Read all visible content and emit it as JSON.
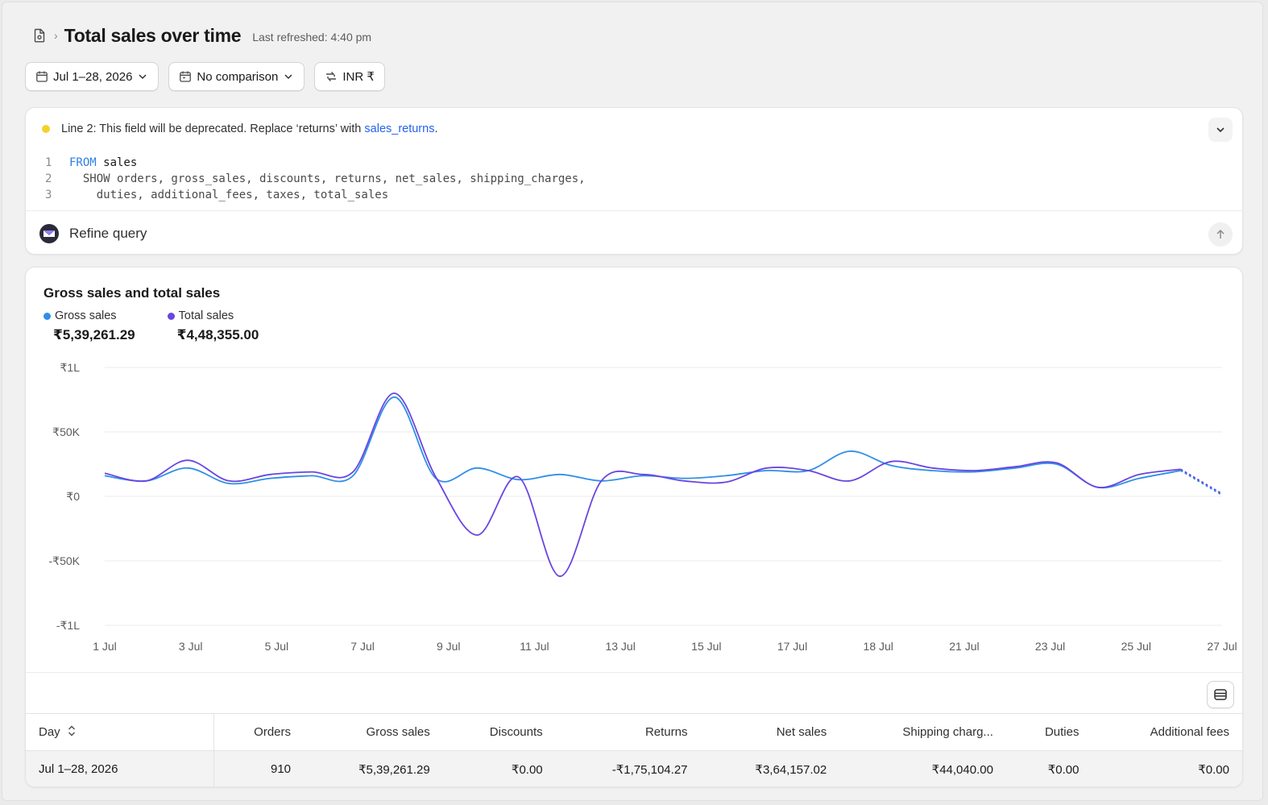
{
  "header": {
    "title": "Total sales over time",
    "last_refreshed": "Last refreshed: 4:40 pm"
  },
  "toolbar": {
    "date_range": "Jul 1–28, 2026",
    "comparison": "No comparison",
    "currency": "INR ₹"
  },
  "query": {
    "warning_prefix": "Line 2: This field will be deprecated. Replace ‘returns’ with ",
    "warning_link": "sales_returns",
    "warning_suffix": ".",
    "lines": [
      {
        "num": "1",
        "keyword": "FROM",
        "rest": " sales"
      },
      {
        "num": "2",
        "text": "  SHOW orders, gross_sales, discounts, returns, net_sales, shipping_charges,"
      },
      {
        "num": "3",
        "text": "    duties, additional_fees, taxes, total_sales"
      }
    ],
    "refine_label": "Refine query"
  },
  "colors": {
    "gross_sales": "#2f8fe8",
    "total_sales": "#6a45e0",
    "warning": "#f5d22b"
  },
  "chart_data": {
    "type": "line",
    "title": "Gross sales and total sales",
    "x": [
      "1 Jul",
      "2 Jul",
      "3 Jul",
      "4 Jul",
      "5 Jul",
      "6 Jul",
      "7 Jul",
      "8 Jul",
      "9 Jul",
      "10 Jul",
      "11 Jul",
      "12 Jul",
      "13 Jul",
      "14 Jul",
      "15 Jul",
      "16 Jul",
      "17 Jul",
      "18 Jul",
      "19 Jul",
      "20 Jul",
      "21 Jul",
      "22 Jul",
      "23 Jul",
      "24 Jul",
      "25 Jul",
      "26 Jul",
      "27 Jul",
      "28 Jul"
    ],
    "tick_labels": [
      "1 Jul",
      "3 Jul",
      "5 Jul",
      "7 Jul",
      "9 Jul",
      "11 Jul",
      "13 Jul",
      "15 Jul",
      "17 Jul",
      "18 Jul",
      "21 Jul",
      "23 Jul",
      "25 Jul",
      "27 Jul"
    ],
    "y_tick_labels": [
      "₹1L",
      "₹50K",
      "₹0",
      "-₹50K",
      "-₹1L"
    ],
    "y_ticks": [
      100000,
      50000,
      0,
      -50000,
      -100000
    ],
    "ylim": [
      -100000,
      100000
    ],
    "grid": true,
    "series": [
      {
        "name": "Gross sales",
        "total": "₹5,39,261.29",
        "values": [
          16000,
          12000,
          22000,
          10000,
          14000,
          16000,
          16000,
          77000,
          14000,
          22000,
          13000,
          17000,
          12000,
          16000,
          14000,
          16000,
          20000,
          20000,
          35000,
          24000,
          20000,
          19000,
          22000,
          25000,
          7000,
          14000,
          20000,
          1000
        ],
        "projected_from": 26
      },
      {
        "name": "Total sales",
        "total": "₹4,48,355.00",
        "values": [
          18000,
          12000,
          28000,
          12000,
          17000,
          19000,
          19000,
          80000,
          15000,
          -30000,
          15000,
          -62000,
          12000,
          17000,
          12000,
          11000,
          22000,
          20000,
          12000,
          27000,
          22000,
          20000,
          23000,
          26000,
          7000,
          17000,
          21000,
          2000
        ],
        "projected_from": 26
      }
    ]
  },
  "table": {
    "columns": [
      "Day",
      "Orders",
      "Gross sales",
      "Discounts",
      "Returns",
      "Net sales",
      "Shipping charg...",
      "Duties",
      "Additional fees"
    ],
    "rows": [
      [
        "Jul 1–28, 2026",
        "910",
        "₹5,39,261.29",
        "₹0.00",
        "-₹1,75,104.27",
        "₹3,64,157.02",
        "₹44,040.00",
        "₹0.00",
        "₹0.00"
      ]
    ]
  }
}
